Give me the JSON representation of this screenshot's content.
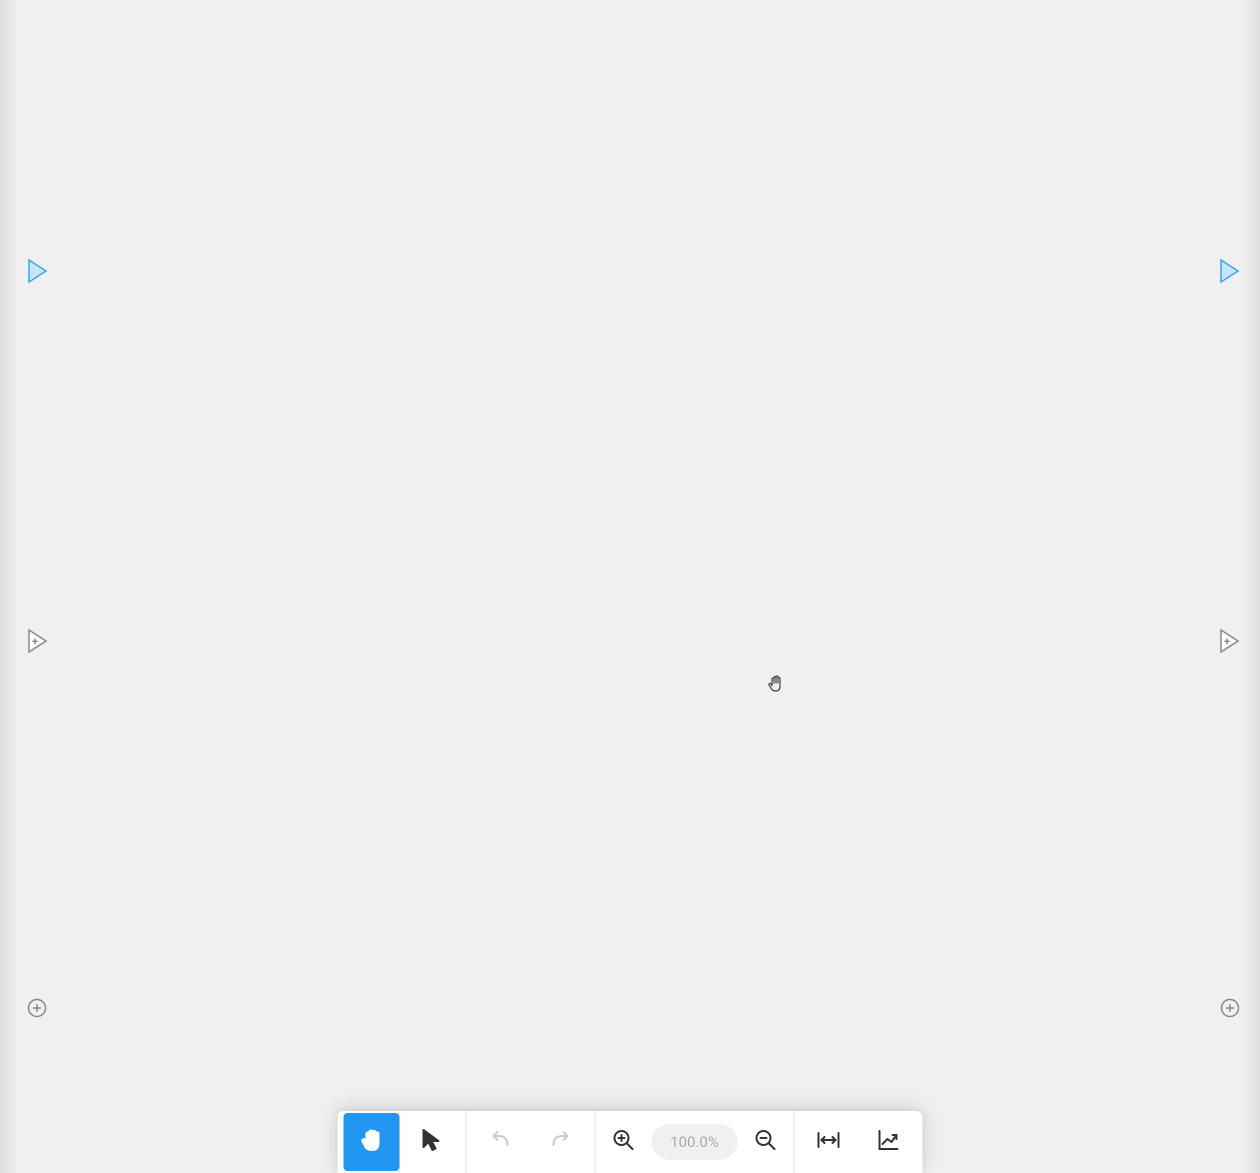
{
  "canvas": {
    "cursor_mode": "hand"
  },
  "side_controls": {
    "left": {
      "play_marker": "play",
      "add_marker": "add-section",
      "add_node": "add-node"
    },
    "right": {
      "play_marker": "play",
      "add_marker": "add-section",
      "add_node": "add-node"
    }
  },
  "toolbar": {
    "hand_tool": "Hand",
    "pointer_tool": "Pointer",
    "undo": "Undo",
    "redo": "Redo",
    "zoom_in": "Zoom In",
    "zoom_out": "Zoom Out",
    "zoom_value": "100.0%",
    "fit_width": "Fit Width",
    "chart_view": "Chart"
  },
  "colors": {
    "accent": "#2196f3",
    "accent_light": "#c8e4fa",
    "canvas_bg": "#f0f0f0",
    "toolbar_bg": "#ffffff",
    "icon_default": "#333333",
    "icon_disabled": "#cccccc",
    "icon_muted": "#888888"
  }
}
